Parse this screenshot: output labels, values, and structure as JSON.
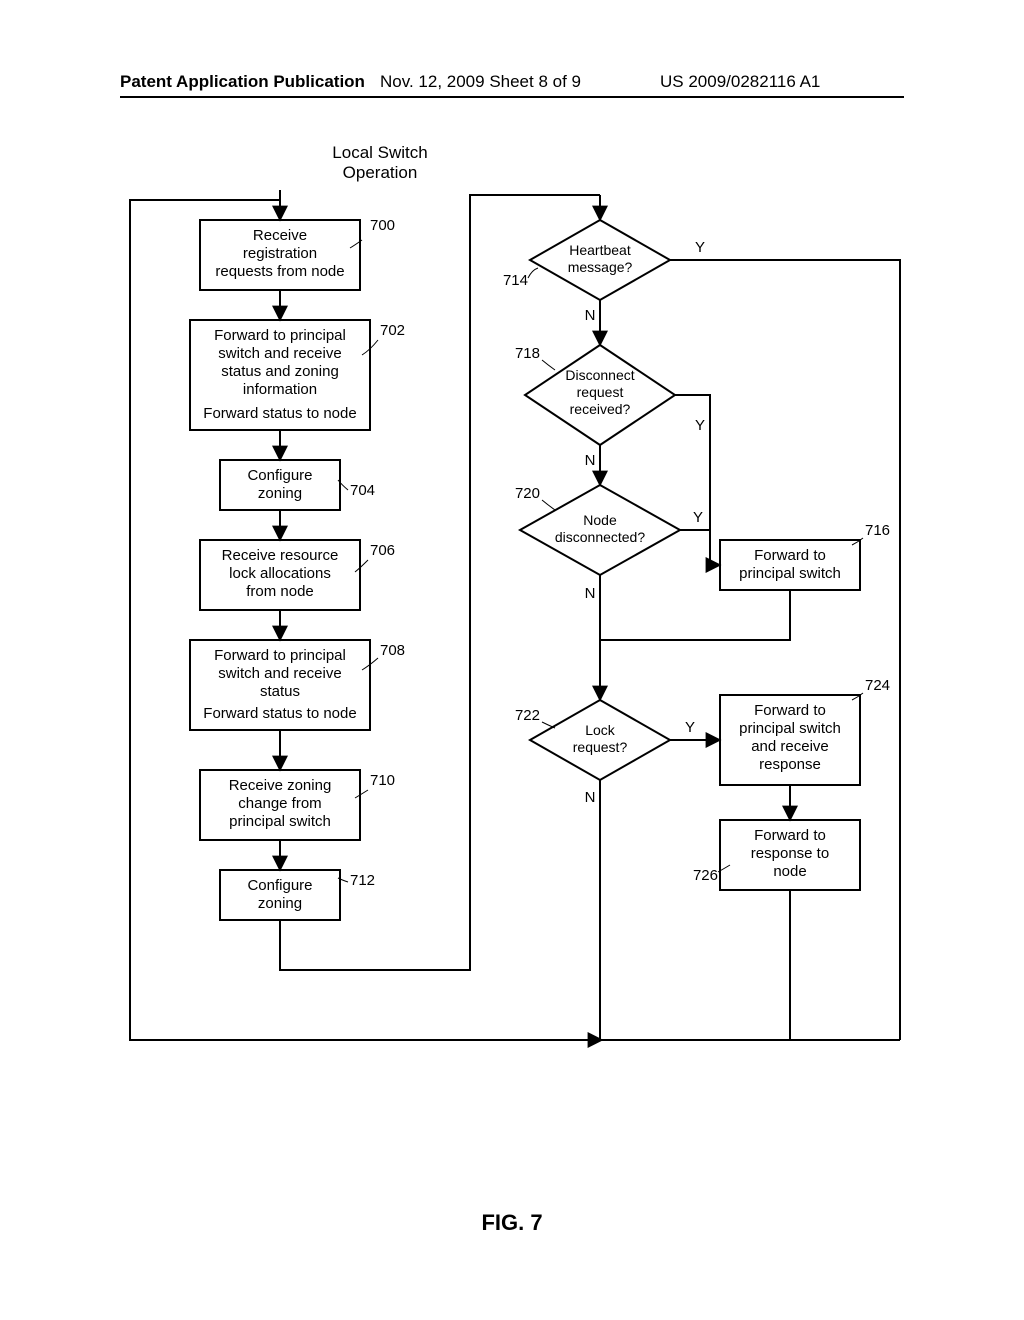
{
  "header": {
    "left": "Patent Application Publication",
    "center": "Nov. 12, 2009  Sheet 8 of 9",
    "right": "US 2009/0282116 A1"
  },
  "figure_label": "FIG. 7",
  "title_line1": "Local Switch",
  "title_line2": "Operation",
  "refs": {
    "b700": "700",
    "b702": "702",
    "b704": "704",
    "b706": "706",
    "b708": "708",
    "b710": "710",
    "b712": "712",
    "d714": "714",
    "d718": "718",
    "d720": "720",
    "d722": "722",
    "b716": "716",
    "b724": "724",
    "b726": "726"
  },
  "boxes": {
    "b700_l1": "Receive",
    "b700_l2": "registration",
    "b700_l3": "requests from node",
    "b702_l1": "Forward to principal",
    "b702_l2": "switch and receive",
    "b702_l3": "status and zoning",
    "b702_l4": "information",
    "b702_l5": "Forward status to node",
    "b704_l1": "Configure",
    "b704_l2": "zoning",
    "b706_l1": "Receive resource",
    "b706_l2": "lock allocations",
    "b706_l3": "from node",
    "b708_l1": "Forward to principal",
    "b708_l2": "switch and receive",
    "b708_l3": "status",
    "b708_l4": "Forward status to node",
    "b710_l1": "Receive zoning",
    "b710_l2": "change from",
    "b710_l3": "principal switch",
    "b712_l1": "Configure",
    "b712_l2": "zoning",
    "b716_l1": "Forward to",
    "b716_l2": "principal switch",
    "b724_l1": "Forward to",
    "b724_l2": "principal switch",
    "b724_l3": "and receive",
    "b724_l4": "response",
    "b726_l1": "Forward to",
    "b726_l2": "response to",
    "b726_l3": "node"
  },
  "diamonds": {
    "d714_l1": "Heartbeat",
    "d714_l2": "message?",
    "d718_l1": "Disconnect",
    "d718_l2": "request",
    "d718_l3": "received?",
    "d720_l1": "Node",
    "d720_l2": "disconnected?",
    "d722_l1": "Lock",
    "d722_l2": "request?"
  },
  "yn": {
    "y": "Y",
    "n": "N"
  }
}
